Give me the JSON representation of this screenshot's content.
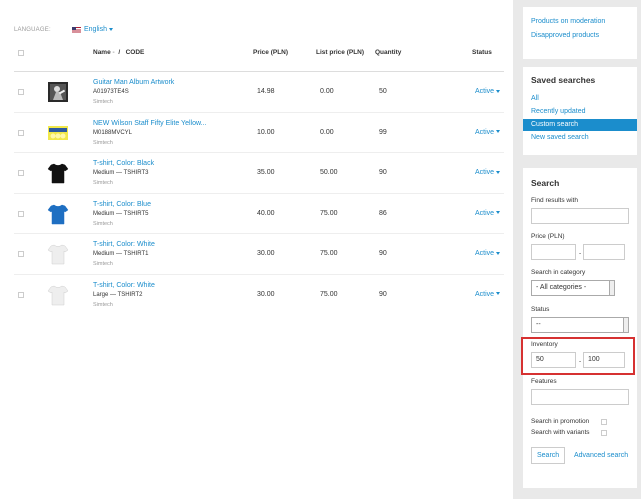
{
  "language": {
    "label": "LANGUAGE:",
    "value": "English"
  },
  "table": {
    "headers": {
      "name": "Name",
      "sort": "-",
      "sep": "/",
      "code": "CODE",
      "price": "Price (PLN)",
      "list_price": "List price (PLN)",
      "quantity": "Quantity",
      "status": "Status"
    },
    "rows": [
      {
        "name": "Guitar Man Album Artwork",
        "code": "A01973TE4S",
        "vendor": "Simtech",
        "price": "14.98",
        "list_price": "0.00",
        "quantity": "50",
        "status": "Active",
        "thumb": "album-art"
      },
      {
        "name": "NEW Wilson Staff Fifty Elite Yellow...",
        "code": "M0188MVCYL",
        "vendor": "Simtech",
        "price": "10.00",
        "list_price": "0.00",
        "quantity": "99",
        "status": "Active",
        "thumb": "golf-balls"
      },
      {
        "name": "T-shirt, Color: Black",
        "code": "Medium — TSHIRT3",
        "vendor": "Simtech",
        "price": "35.00",
        "list_price": "50.00",
        "quantity": "90",
        "status": "Active",
        "thumb": "tshirt",
        "color": "#111111"
      },
      {
        "name": "T-shirt, Color: Blue",
        "code": "Medium — TSHIRT5",
        "vendor": "Simtech",
        "price": "40.00",
        "list_price": "75.00",
        "quantity": "86",
        "status": "Active",
        "thumb": "tshirt",
        "color": "#1e6fc2"
      },
      {
        "name": "T-shirt, Color: White",
        "code": "Medium — TSHIRT1",
        "vendor": "Simtech",
        "price": "30.00",
        "list_price": "75.00",
        "quantity": "90",
        "status": "Active",
        "thumb": "tshirt",
        "color": "#eeeeee"
      },
      {
        "name": "T-shirt, Color: White",
        "code": "Large — TSHIRT2",
        "vendor": "Simtech",
        "price": "30.00",
        "list_price": "75.00",
        "quantity": "90",
        "status": "Active",
        "thumb": "tshirt",
        "color": "#eeeeee"
      }
    ]
  },
  "sidebar": {
    "moderation": {
      "products_on_moderation": "Products on moderation",
      "disapproved_products": "Disapproved products"
    },
    "saved_searches": {
      "title": "Saved searches",
      "items": [
        "All",
        "Recently updated",
        "Custom search",
        "New saved search"
      ],
      "active": "Custom search"
    },
    "search": {
      "title": "Search",
      "find_results_label": "Find results with",
      "find_results_value": "",
      "price_label": "Price (PLN)",
      "price_from": "",
      "price_to": "",
      "price_sep": "-",
      "category_label": "Search in category",
      "category_value": "- All categories -",
      "status_label": "Status",
      "status_value": "--",
      "inventory_label": "Inventory",
      "inventory_from": "50",
      "inventory_to": "100",
      "inventory_sep": "-",
      "features_label": "Features",
      "features_value": "",
      "promotion_label": "Search in promotion",
      "variants_label": "Search with variants",
      "search_button": "Search",
      "advanced_search": "Advanced search"
    }
  },
  "colors": {
    "link": "#1b8dcc",
    "highlight": "#d63131"
  }
}
